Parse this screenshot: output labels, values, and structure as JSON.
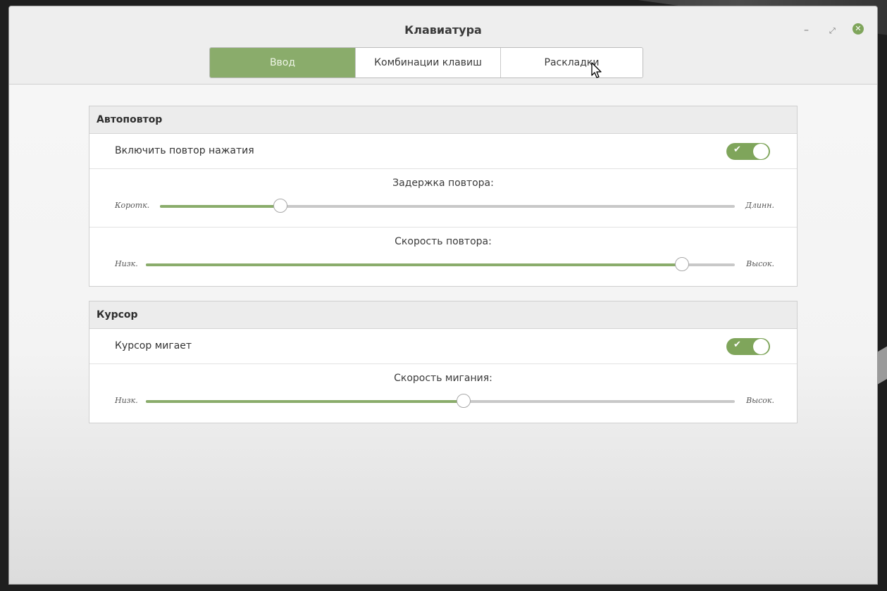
{
  "window": {
    "title": "Клавиатура",
    "controls": {
      "minimize": "–",
      "maximize": "⤢",
      "close": "✕"
    }
  },
  "tabs": [
    {
      "label": "Ввод",
      "active": true
    },
    {
      "label": "Комбинации клавиш",
      "active": false
    },
    {
      "label": "Раскладки",
      "active": false
    }
  ],
  "autorepeat": {
    "header": "Автоповтор",
    "enable_label": "Включить повтор нажатия",
    "enable_on": true,
    "delay": {
      "title": "Задержка повтора:",
      "min_label": "Коротк.",
      "max_label": "Длинн.",
      "value": 0.21
    },
    "speed": {
      "title": "Скорость повтора:",
      "min_label": "Низк.",
      "max_label": "Высок.",
      "value": 0.91
    }
  },
  "cursor": {
    "header": "Курсор",
    "blink_label": "Курсор мигает",
    "blink_on": true,
    "blink_speed": {
      "title": "Скорость мигания:",
      "min_label": "Низк.",
      "max_label": "Высок.",
      "value": 0.54
    }
  },
  "colors": {
    "accent": "#8aac6b",
    "toggle": "#7fa55b",
    "track": "#c8c8c8"
  },
  "icons": {
    "toggle_check": "check-icon",
    "pointer": "mouse-pointer-icon"
  }
}
